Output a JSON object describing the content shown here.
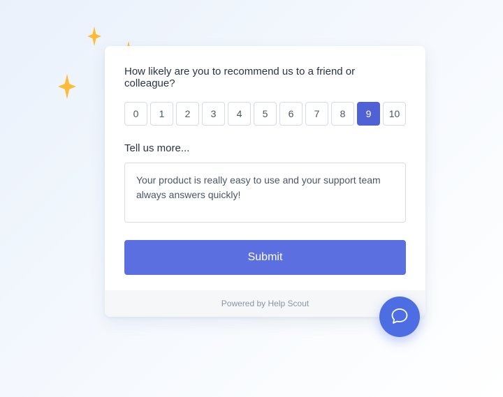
{
  "survey": {
    "question": "How likely are you to recommend us to a friend or colleague?",
    "scale": {
      "values": [
        "0",
        "1",
        "2",
        "3",
        "4",
        "5",
        "6",
        "7",
        "8",
        "9",
        "10"
      ],
      "selected_index": 9
    },
    "followup_label": "Tell us more...",
    "followup_value": "Your product is really easy to use and your support team always answers quickly!",
    "submit_label": "Submit"
  },
  "footer": {
    "powered_by": "Powered by Help Scout"
  },
  "icons": {
    "chat_fab": "chat-bubble-icon",
    "sparkle": "sparkle-icon"
  },
  "colors": {
    "accent": "#5061d6",
    "accent_light": "#5b6fe0",
    "fab": "#4d6de3",
    "sparkle": "#FFBB33"
  }
}
